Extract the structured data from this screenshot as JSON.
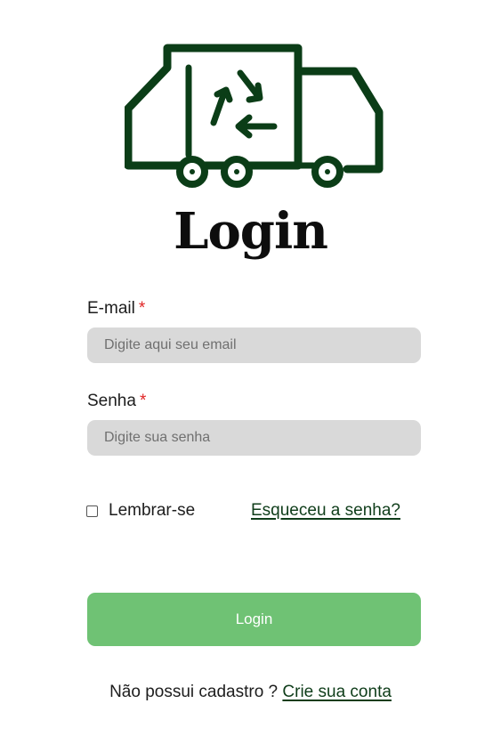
{
  "brand": {
    "logo_icon": "recycling-truck-icon",
    "color": "#0b3d17"
  },
  "page": {
    "title": "Login"
  },
  "form": {
    "email": {
      "label": "E-mail",
      "required_mark": "*",
      "placeholder": "Digite aqui seu email",
      "value": ""
    },
    "password": {
      "label": "Senha",
      "required_mark": "*",
      "placeholder": "Digite sua senha",
      "value": ""
    },
    "remember": {
      "label": "Lembrar-se",
      "checked": false
    },
    "forgot_link": "Esqueceu a senha?",
    "submit_label": "Login"
  },
  "signup": {
    "prompt": "Não possui cadastro ?",
    "link": "Crie sua conta"
  },
  "colors": {
    "button": "#6fc274",
    "input_bg": "#d9d9d9",
    "required": "#e02424",
    "link": "#0f3d1a"
  }
}
